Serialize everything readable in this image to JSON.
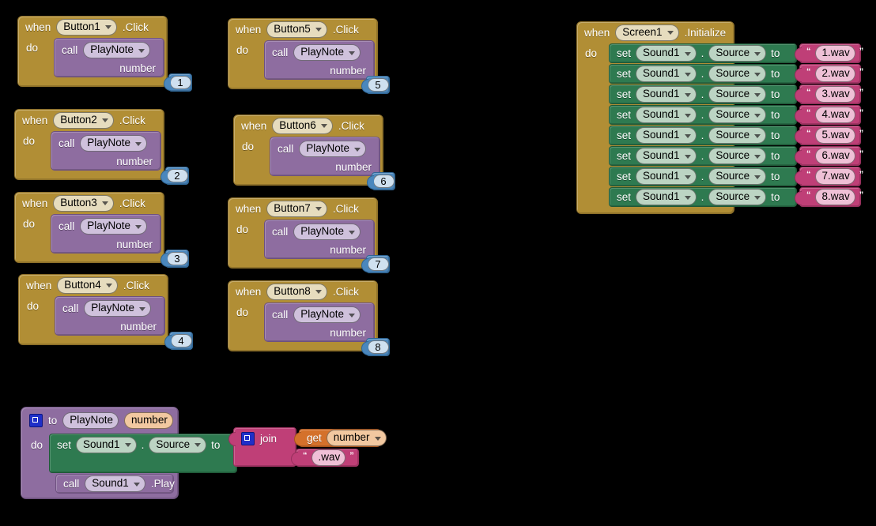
{
  "app": {
    "title": "MIT App Inventor Blocks Editor",
    "canvas_background": "#000000"
  },
  "palette": {
    "event_block": "#B18E35",
    "procedure_block": "#8E6DA0",
    "setter_block": "#2E7A50",
    "text_block": "#BF3F77",
    "math_block": "#4A87BD",
    "variable_block": "#D4712B"
  },
  "labels": {
    "when": "when",
    "do": "do",
    "call": "call",
    "set": "set",
    "to": "to",
    "get": "get",
    "join": "join",
    "dot": ".",
    "number_param": "number",
    "open_quote": "“",
    "close_quote": "”"
  },
  "event_blocks": [
    {
      "when": "when",
      "component": "Button1",
      "event": ".Click",
      "do": "do",
      "call": "call",
      "procedure": "PlayNote",
      "arg_label": "number",
      "arg_value": "1"
    },
    {
      "when": "when",
      "component": "Button2",
      "event": ".Click",
      "do": "do",
      "call": "call",
      "procedure": "PlayNote",
      "arg_label": "number",
      "arg_value": "2"
    },
    {
      "when": "when",
      "component": "Button3",
      "event": ".Click",
      "do": "do",
      "call": "call",
      "procedure": "PlayNote",
      "arg_label": "number",
      "arg_value": "3"
    },
    {
      "when": "when",
      "component": "Button4",
      "event": ".Click",
      "do": "do",
      "call": "call",
      "procedure": "PlayNote",
      "arg_label": "number",
      "arg_value": "4"
    },
    {
      "when": "when",
      "component": "Button5",
      "event": ".Click",
      "do": "do",
      "call": "call",
      "procedure": "PlayNote",
      "arg_label": "number",
      "arg_value": "5"
    },
    {
      "when": "when",
      "component": "Button6",
      "event": ".Click",
      "do": "do",
      "call": "call",
      "procedure": "PlayNote",
      "arg_label": "number",
      "arg_value": "6"
    },
    {
      "when": "when",
      "component": "Button7",
      "event": ".Click",
      "do": "do",
      "call": "call",
      "procedure": "PlayNote",
      "arg_label": "number",
      "arg_value": "7"
    },
    {
      "when": "when",
      "component": "Button8",
      "event": ".Click",
      "do": "do",
      "call": "call",
      "procedure": "PlayNote",
      "arg_label": "number",
      "arg_value": "8"
    }
  ],
  "screen_init": {
    "when": "when",
    "component": "Screen1",
    "event": ".Initialize",
    "do": "do",
    "rows": [
      {
        "set": "set",
        "object": "Sound1",
        "property": "Source",
        "to": "to",
        "value": "1.wav"
      },
      {
        "set": "set",
        "object": "Sound1",
        "property": "Source",
        "to": "to",
        "value": "2.wav"
      },
      {
        "set": "set",
        "object": "Sound1",
        "property": "Source",
        "to": "to",
        "value": "3.wav"
      },
      {
        "set": "set",
        "object": "Sound1",
        "property": "Source",
        "to": "to",
        "value": "4.wav"
      },
      {
        "set": "set",
        "object": "Sound1",
        "property": "Source",
        "to": "to",
        "value": "5.wav"
      },
      {
        "set": "set",
        "object": "Sound1",
        "property": "Source",
        "to": "to",
        "value": "6.wav"
      },
      {
        "set": "set",
        "object": "Sound1",
        "property": "Source",
        "to": "to",
        "value": "7.wav"
      },
      {
        "set": "set",
        "object": "Sound1",
        "property": "Source",
        "to": "to",
        "value": "8.wav"
      }
    ]
  },
  "procedure_def": {
    "to": "to",
    "name": "PlayNote",
    "param": "number",
    "do": "do",
    "setter": {
      "set": "set",
      "object": "Sound1",
      "property": "Source",
      "to": "to"
    },
    "join": {
      "label": "join",
      "arg1_get": "get",
      "arg1_var": "number",
      "arg2_text": ".wav"
    },
    "call": {
      "call": "call",
      "object": "Sound1",
      "method": ".Play"
    }
  }
}
